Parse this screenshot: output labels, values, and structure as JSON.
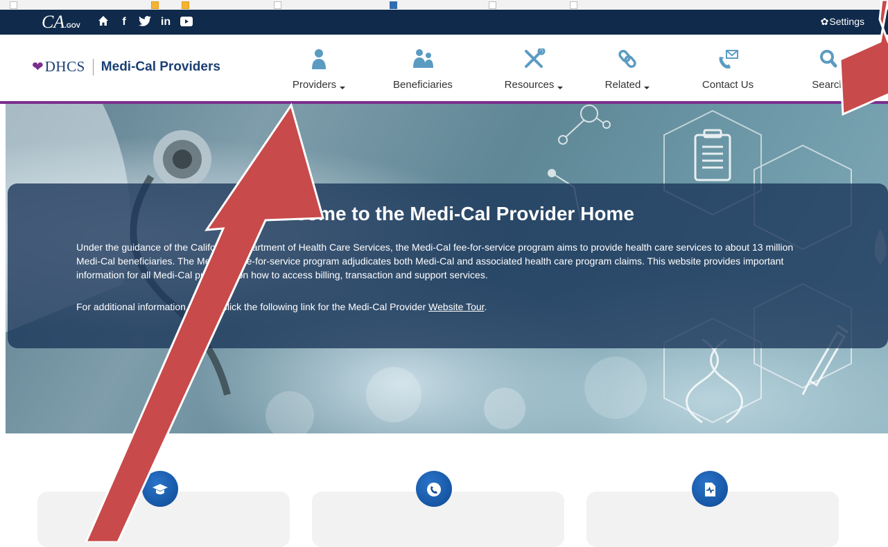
{
  "topbar": {
    "ca_logo": "CA",
    "ca_logo_suffix": ".GOV",
    "social": [
      {
        "icon": "home-icon",
        "glyph": "⌂"
      },
      {
        "icon": "facebook-icon",
        "glyph": "f"
      },
      {
        "icon": "twitter-icon",
        "glyph": "🐦"
      },
      {
        "icon": "linkedin-icon",
        "glyph": "in"
      },
      {
        "icon": "youtube-icon",
        "glyph": "▶"
      }
    ],
    "settings_label": "Settings"
  },
  "header": {
    "brand_dhcs": "DHCS",
    "brand_title": "Medi-Cal Providers",
    "nav": [
      {
        "label": "Providers",
        "icon": "provider-person-icon",
        "dropdown": true
      },
      {
        "label": "Beneficiaries",
        "icon": "beneficiaries-group-icon",
        "dropdown": false
      },
      {
        "label": "Resources",
        "icon": "tools-icon",
        "dropdown": true
      },
      {
        "label": "Related",
        "icon": "link-icon",
        "dropdown": true
      },
      {
        "label": "Contact Us",
        "icon": "contact-phone-mail-icon",
        "dropdown": false
      },
      {
        "label": "Search",
        "icon": "search-icon",
        "dropdown": false
      }
    ],
    "accent_color": "#7b2d8e",
    "icon_color": "#5b9bc2"
  },
  "hero": {
    "title": "Welcome to the Medi-Cal Provider Home",
    "paragraph": "Under the guidance of the California Department of Health Care Services, the Medi-Cal fee-for-service program aims to provide health care services to about 13 million Medi-Cal beneficiaries. The Medi-Cal fee-for-service program adjudicates both Medi-Cal and associated health care program claims. This website provides important information for all Medi-Cal providers on how to access billing, transaction and support services.",
    "tour_prefix": "For additional information, please click the following link for the Medi-Cal Provider ",
    "tour_link": "Website Tour",
    "tour_suffix": "."
  },
  "cards": [
    {
      "icon": "graduation-cap-icon"
    },
    {
      "icon": "phone-circle-icon"
    },
    {
      "icon": "medical-document-icon"
    }
  ],
  "annotation_color": "#c84a4a"
}
